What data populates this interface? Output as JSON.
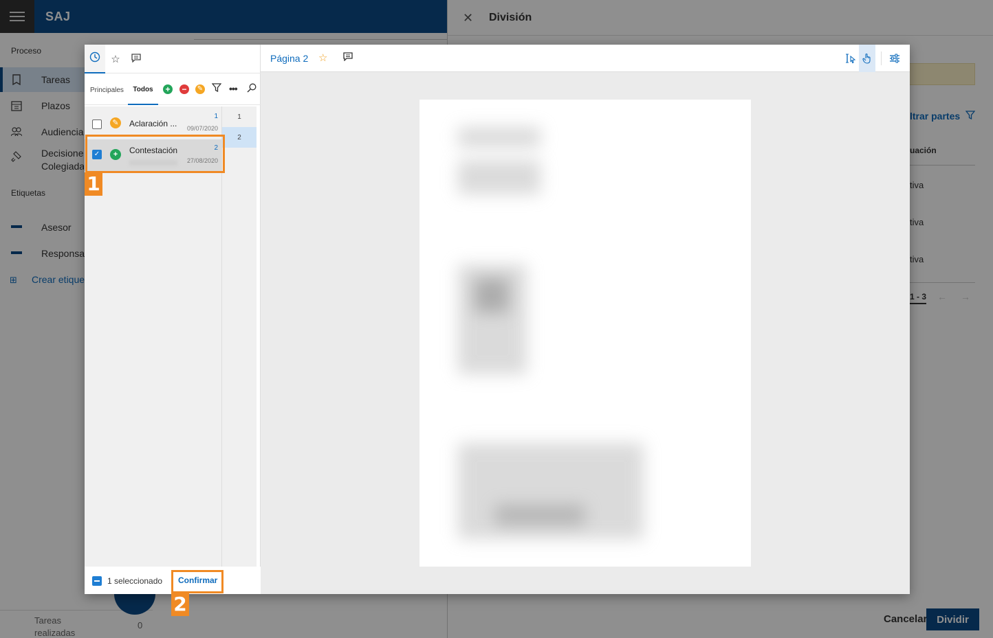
{
  "app": {
    "title": "SAJ",
    "sidebar": {
      "section_proceso": "Proceso",
      "items": [
        {
          "label": "Tareas",
          "icon": "bookmark-icon"
        },
        {
          "label": "Plazos",
          "icon": "calendar-icon"
        },
        {
          "label": "Audiencia",
          "icon": "people-icon"
        },
        {
          "label": "Decisiones Colegiada",
          "icon": "gavel-icon"
        }
      ],
      "section_etiquetas": "Etiquetas",
      "tags": [
        "Asesor",
        "Responsab"
      ],
      "create_tag": "Crear etique",
      "footer_label": "Tareas realizadas",
      "footer_count": "0"
    }
  },
  "panel": {
    "title": "División",
    "filter_label": "ltrar partes",
    "column_header": "uación",
    "rows": [
      "tiva",
      "tiva",
      "tiva"
    ],
    "pagination": "1 - 3",
    "cancel_label": "Cancelar",
    "divide_label": "Dividir"
  },
  "modal": {
    "subtabs": {
      "principales": "Principales",
      "todos": "Todos"
    },
    "documents": [
      {
        "title": "Aclaración ...",
        "date": "09/07/2020",
        "number": "1",
        "checked": false,
        "icon_color": "#f5a623"
      },
      {
        "title": "Contestación",
        "date": "27/08/2020",
        "number": "2",
        "checked": true,
        "icon_color": "#23a55a"
      }
    ],
    "pages": [
      "1",
      "2"
    ],
    "footer": {
      "selected_text": "1 seleccionado",
      "confirm_label": "Confirmar"
    },
    "viewer": {
      "page_title": "Página 2"
    },
    "callouts": [
      "1",
      "2"
    ],
    "accent_color": "#f08a24"
  }
}
